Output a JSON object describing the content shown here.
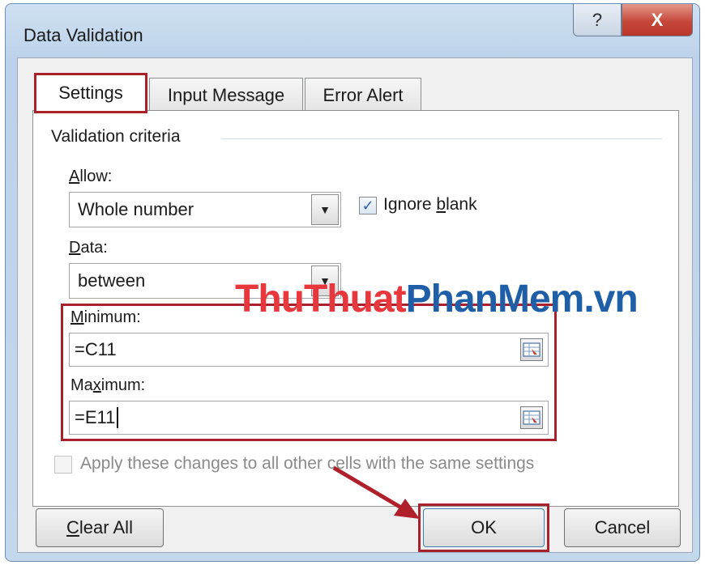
{
  "window": {
    "title": "Data Validation",
    "help_glyph": "?",
    "close_glyph": "X"
  },
  "tabs": [
    {
      "label": "Settings",
      "active": true
    },
    {
      "label": "Input Message",
      "active": false
    },
    {
      "label": "Error Alert",
      "active": false
    }
  ],
  "settings": {
    "group_label": "Validation criteria",
    "allow": {
      "label_hotkey": "A",
      "label_rest": "llow:",
      "value": "Whole number"
    },
    "ignore_blank": {
      "label_pre": "Ignore ",
      "label_hotkey": "b",
      "label_post": "lank",
      "checked": true
    },
    "data": {
      "label_hotkey": "D",
      "label_rest": "ata:",
      "value": "between"
    },
    "minimum": {
      "label_hotkey": "M",
      "label_rest": "inimum:",
      "value": "=C11"
    },
    "maximum": {
      "label_pre": "Ma",
      "label_hotkey": "x",
      "label_rest": "imum:",
      "value": "=E11"
    },
    "apply_all": {
      "label": "Apply these changes to all other cells with the same settings",
      "checked": false,
      "enabled": false
    }
  },
  "buttons": {
    "clear_all_hotkey": "C",
    "clear_all_rest": "lear All",
    "ok": "OK",
    "cancel": "Cancel"
  },
  "watermark": {
    "part1": "ThuThuat",
    "part2": "PhanMem",
    "part3": ".vn",
    "color_red": "#e8383d",
    "color_blue": "#1f5fa8"
  },
  "colors": {
    "highlight_box": "#a8212b",
    "arrow": "#b0202a",
    "close_button": "#c6483a"
  }
}
